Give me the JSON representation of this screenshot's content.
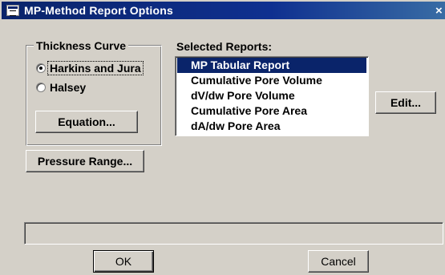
{
  "window": {
    "title": "MP-Method Report Options",
    "close_glyph": "×"
  },
  "thickness_curve": {
    "legend": "Thickness Curve",
    "options": [
      {
        "label": "Harkins and Jura",
        "checked": true
      },
      {
        "label": "Halsey",
        "checked": false
      }
    ],
    "equation_button": "Equation..."
  },
  "pressure_range_button": "Pressure Range...",
  "selected_reports": {
    "label": "Selected Reports:",
    "items": [
      {
        "label": "MP Tabular Report",
        "selected": true
      },
      {
        "label": "Cumulative Pore Volume",
        "selected": false
      },
      {
        "label": "dV/dw Pore Volume",
        "selected": false
      },
      {
        "label": "Cumulative Pore Area",
        "selected": false
      },
      {
        "label": "dA/dw Pore Area",
        "selected": false
      }
    ]
  },
  "edit_button": "Edit...",
  "status_text": "",
  "ok_button": "OK",
  "cancel_button": "Cancel",
  "colors": {
    "face": "#d4d0c8",
    "titlebar": "#0a246a",
    "selection": "#0a246a"
  }
}
